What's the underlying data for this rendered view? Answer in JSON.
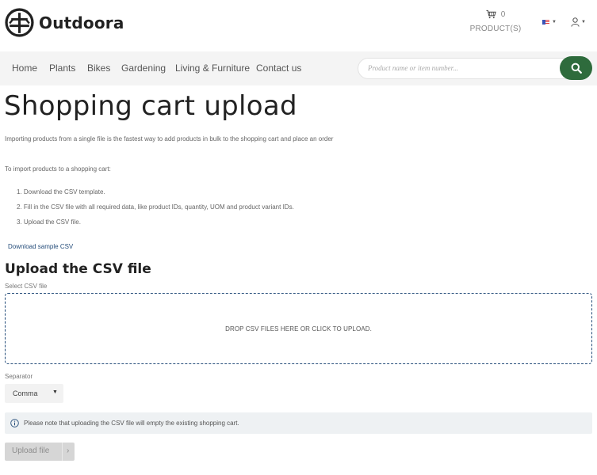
{
  "brand": {
    "name": "Outdoora",
    "primary_color": "#2e6b3c",
    "link_color": "#254d7a"
  },
  "header": {
    "cart": {
      "count": "0",
      "label": "PRODUCT(S)",
      "icon": "cart-icon"
    },
    "language_icon": "us-flag-icon",
    "account_icon": "user-icon"
  },
  "nav": {
    "items": [
      "Home",
      "Plants",
      "Bikes",
      "Gardening",
      "Living & Furniture",
      "Contact us"
    ]
  },
  "search": {
    "placeholder": "Product name or item number...",
    "button_icon": "search-icon"
  },
  "page": {
    "title": "Shopping cart upload",
    "intro": "Importing products from a single file is the fastest way to add products in bulk to the shopping cart and place an order",
    "steps_intro": "To import products to a shopping cart:",
    "steps": [
      "1. Download the CSV template.",
      "2. Fill in the CSV file with all required data, like product IDs, quantity, UOM and product variant IDs.",
      "3. Upload the CSV file."
    ],
    "download_link": "Download sample CSV"
  },
  "upload": {
    "section_title": "Upload the CSV file",
    "file_label": "Select CSV file",
    "dropzone_text": "DROP CSV FILES HERE OR CLICK TO UPLOAD.",
    "separator_label": "Separator",
    "separator_value": "Comma",
    "note": "Please note that uploading the CSV file will empty the existing shopping cart.",
    "button_label": "Upload file",
    "button_chevron": "›"
  }
}
